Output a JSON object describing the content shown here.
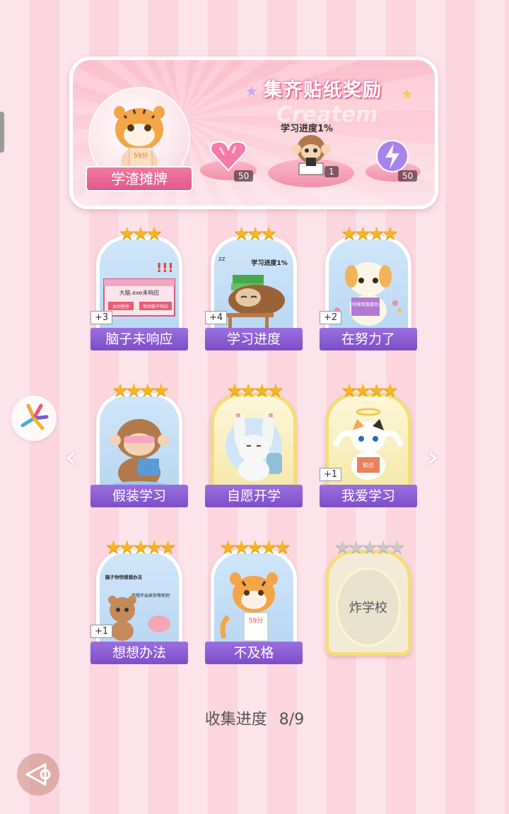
{
  "banner": {
    "title": "集齐贴纸奖励",
    "subtitle_watermark": "Createm",
    "player_name": "学渣摊牌",
    "avatar_score_text": "59分",
    "progress_text": "学习进度1%",
    "rewards": [
      {
        "name": "pink-heart-gem",
        "count": "50"
      },
      {
        "name": "monkey-reading",
        "count": "1"
      },
      {
        "name": "purple-lightning-orb",
        "count": "50"
      }
    ]
  },
  "cards": [
    {
      "label": "脑子未响应",
      "stars": 3,
      "dup": "+3",
      "style": "blue",
      "art_text": [
        "大脑.exe未响应",
        "关闭程序",
        "等待脑子响应"
      ]
    },
    {
      "label": "学习进度",
      "stars": 3,
      "dup": "+4",
      "style": "blue",
      "art_text": [
        "学习进度1%"
      ]
    },
    {
      "label": "在努力了",
      "stars": 4,
      "dup": "+2",
      "style": "blue",
      "art_text": [
        "如何套取富婆欢心"
      ]
    },
    {
      "label": "假装学习",
      "stars": 4,
      "dup": "",
      "style": "blue",
      "art_text": []
    },
    {
      "label": "自愿开学",
      "stars": 4,
      "dup": "",
      "style": "gold",
      "art_text": []
    },
    {
      "label": "我爱学习",
      "stars": 4,
      "dup": "+1",
      "style": "gold",
      "art_text": [
        "知识"
      ]
    },
    {
      "label": "想想办法",
      "stars": 5,
      "dup": "+1",
      "style": "blue",
      "art_text": [
        "脑子你快想想办法",
        "我想不出来你等死吧"
      ]
    },
    {
      "label": "不及格",
      "stars": 5,
      "dup": "",
      "style": "blue",
      "art_text": [
        "59分"
      ]
    },
    {
      "label": "炸学校",
      "stars": 5,
      "dup": "",
      "style": "empty",
      "art_text": []
    }
  ],
  "collection": {
    "label": "收集进度",
    "progress": "8/9"
  },
  "colors": {
    "accent_purple": "#8a5ad4",
    "star_gold": "#f6b521",
    "card_blue": "#cfe6fa",
    "card_gold": "#f4dc7a"
  },
  "icons": [
    "left-arrow-icon",
    "right-arrow-icon",
    "back-arrow-icon",
    "pinwheel-logo-icon",
    "star-icon"
  ]
}
